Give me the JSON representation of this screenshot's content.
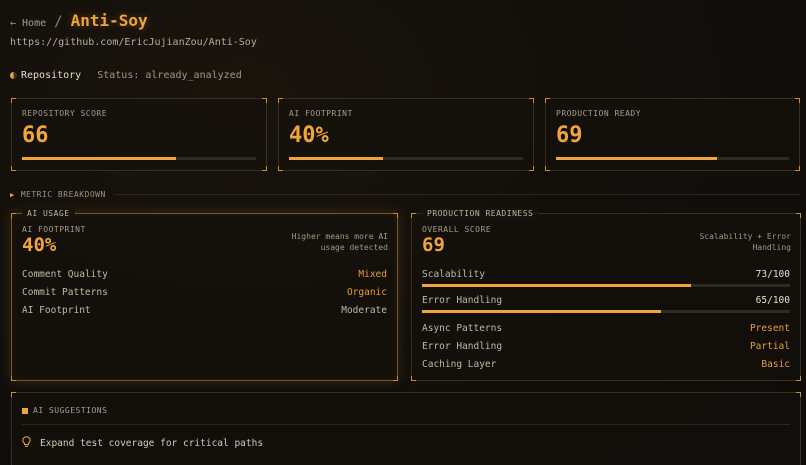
{
  "header": {
    "home_label": "← Home",
    "separator": "/",
    "title": "Anti-Soy",
    "url": "https://github.com/EricJujianZou/Anti-Soy"
  },
  "repo_line": {
    "label": "Repository",
    "status": "Status: already_analyzed"
  },
  "stats": [
    {
      "label": "REPOSITORY SCORE",
      "value": "66",
      "progress": 0.66
    },
    {
      "label": "AI FOOTPRINT",
      "value": "40%",
      "progress": 0.4
    },
    {
      "label": "PRODUCTION READY",
      "value": "69",
      "progress": 0.69
    }
  ],
  "section_title": "METRIC BREAKDOWN",
  "ai_usage": {
    "tag": "AI USAGE",
    "label": "AI FOOTPRINT",
    "value": "40%",
    "note": "Higher means more AI usage detected",
    "rows": [
      {
        "key": "Comment Quality",
        "value": "Mixed",
        "accent": true
      },
      {
        "key": "Commit Patterns",
        "value": "Organic",
        "accent": true
      },
      {
        "key": "AI Footprint",
        "value": "Moderate",
        "accent": false
      }
    ]
  },
  "production": {
    "tag": "PRODUCTION READINESS",
    "label": "OVERALL SCORE",
    "value": "69",
    "note": "Scalability + Error Handling",
    "meters": [
      {
        "key": "Scalability",
        "value": "73/100",
        "progress": 0.73
      },
      {
        "key": "Error Handling",
        "value": "65/100",
        "progress": 0.65
      }
    ],
    "rows": [
      {
        "key": "Async Patterns",
        "value": "Present"
      },
      {
        "key": "Error Handling",
        "value": "Partial"
      },
      {
        "key": "Caching Layer",
        "value": "Basic"
      }
    ]
  },
  "suggestions": {
    "title": "AI SUGGESTIONS",
    "items": [
      "Expand test coverage for critical paths"
    ]
  },
  "colors": {
    "accent": "#f0a53c",
    "background": "#120f0b"
  }
}
